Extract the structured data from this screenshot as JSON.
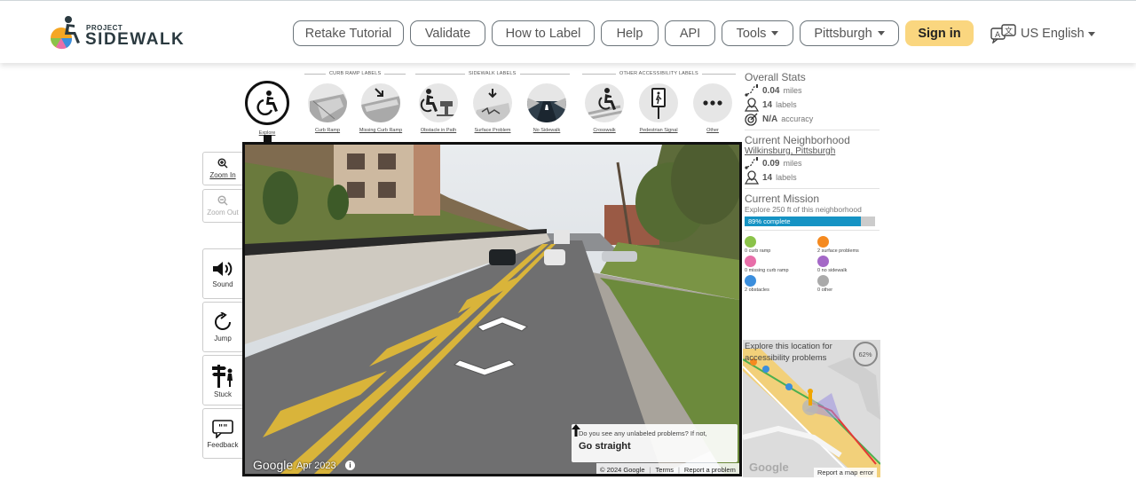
{
  "brand": {
    "line1": "PROJECT",
    "line2": "SIDEWALK"
  },
  "nav": {
    "retake": "Retake Tutorial",
    "validate": "Validate",
    "how_to_label": "How to Label",
    "help": "Help",
    "api": "API",
    "tools": "Tools",
    "city": "Pittsburgh",
    "signin": "Sign in",
    "language": "US English"
  },
  "sections": {
    "curb_ramp": "CURB RAMP LABELS",
    "sidewalk": "SIDEWALK LABELS",
    "other": "OTHER ACCESSIBILITY LABELS"
  },
  "tools": {
    "explore": "Explore",
    "curb_ramp": "Curb Ramp",
    "missing_curb_ramp": "Missing Curb Ramp",
    "obstacle": "Obstacle in Path",
    "surface": "Surface Problem",
    "no_sidewalk": "No Sidewalk",
    "crosswalk": "Crosswalk",
    "ped_signal": "Pedestrian Signal",
    "other": "Other"
  },
  "side": {
    "zoom_in": "Zoom In",
    "zoom_out": "Zoom Out",
    "sound": "Sound",
    "jump": "Jump",
    "stuck": "Stuck",
    "feedback": "Feedback"
  },
  "pano": {
    "google": "Google",
    "date": "Apr 2023",
    "hint_question": "Do you see any unlabeled problems? If not,",
    "hint_action": "Go straight",
    "copyright": "© 2024 Google",
    "terms": "Terms",
    "report": "Report a problem"
  },
  "overall": {
    "title": "Overall Stats",
    "miles_value": "0.04",
    "miles_unit": "miles",
    "labels_value": "14",
    "labels_unit": "labels",
    "accuracy_value": "N/A",
    "accuracy_unit": "accuracy"
  },
  "neighborhood": {
    "title": "Current Neighborhood",
    "name": "Wilkinsburg, Pittsburgh",
    "miles_value": "0.09",
    "miles_unit": "miles",
    "labels_value": "14",
    "labels_unit": "labels"
  },
  "mission": {
    "title": "Current Mission",
    "desc": "Explore 250 ft of this neighborhood",
    "progress_label": "89% complete",
    "progress_pct": 89
  },
  "counts": {
    "curb_ramp": "0 curb ramp",
    "surface": "2 surface problems",
    "missing": "0 missing curb ramp",
    "no_sidewalk": "0 no sidewalk",
    "obstacles": "2 obstacles",
    "other": "0 other"
  },
  "minimap": {
    "caption": "Explore this location for accessibility problems",
    "percent": "62%",
    "google": "Google",
    "report": "Report a map error"
  },
  "colors": {
    "signin_bg": "#fad67f",
    "progress": "#1593c4",
    "curb_ramp": "#8bc34a",
    "missing_curb_ramp": "#e86ea9",
    "obstacle": "#3b8edd",
    "surface": "#f58a1f",
    "no_sidewalk": "#a468c7",
    "other": "#aaaaaa"
  }
}
